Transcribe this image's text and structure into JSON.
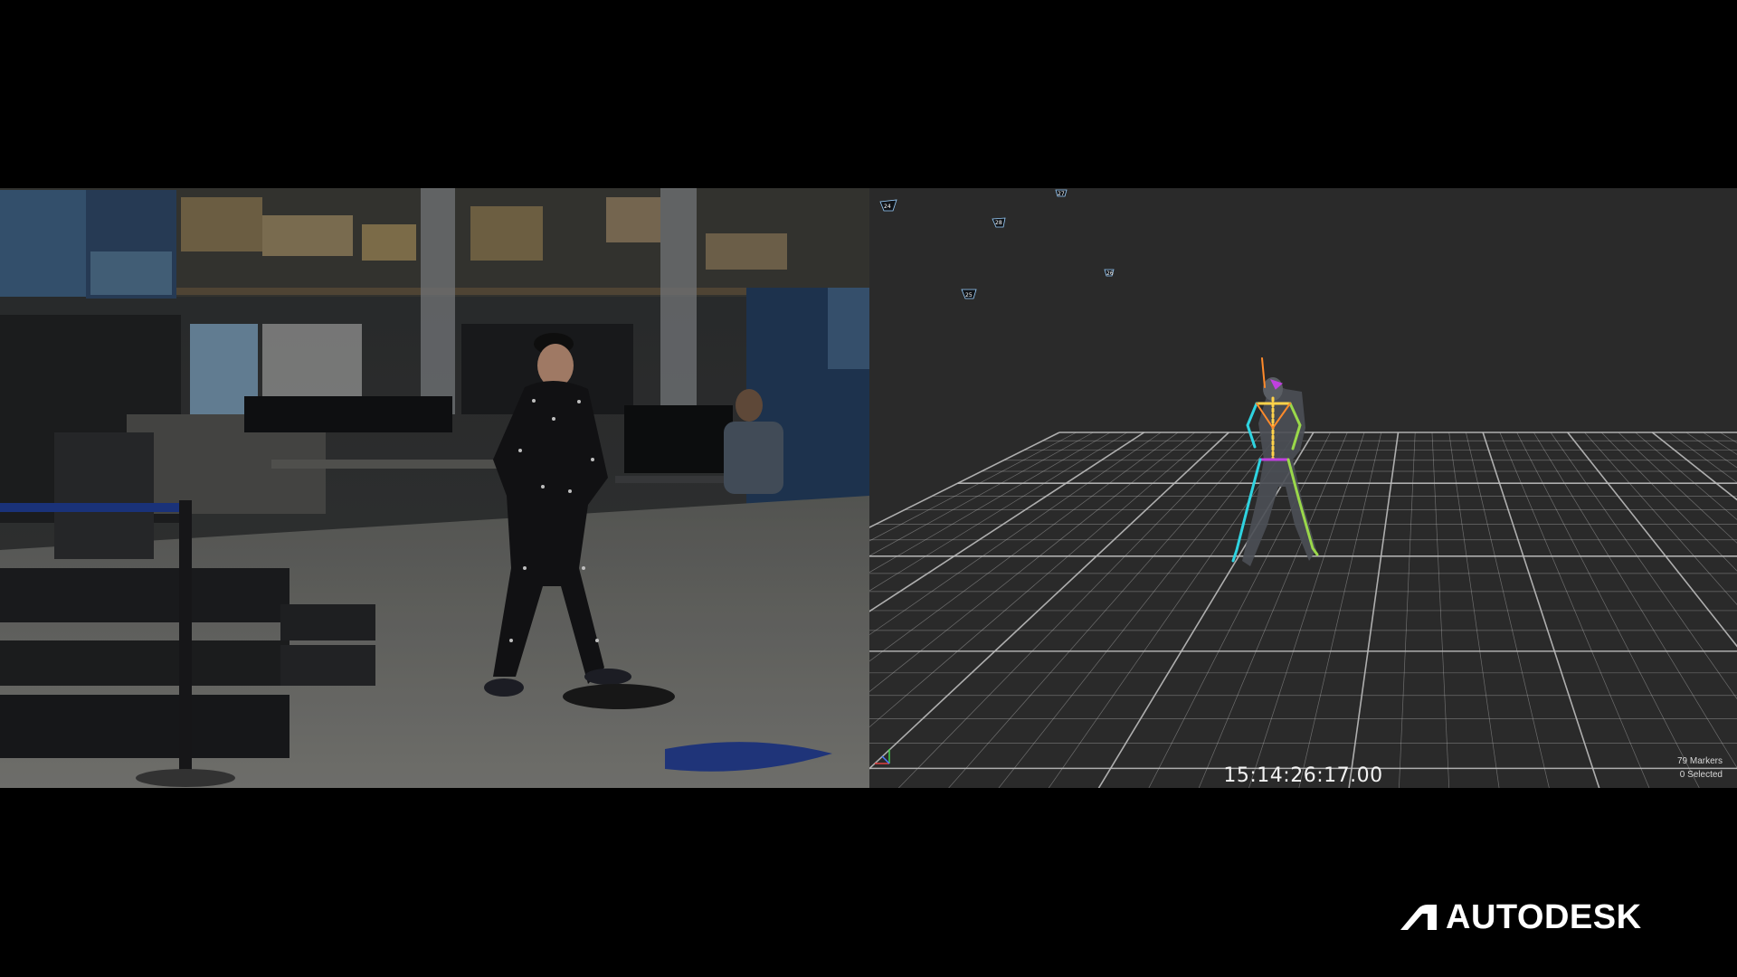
{
  "viewport": {
    "timecode": "15:14:26:17.00",
    "marker_count": "79 Markers",
    "selected_count": "0 Selected",
    "camera_labels": [
      "24",
      "28",
      "27",
      "26",
      "25"
    ]
  },
  "brand": {
    "name": "AUTODESK"
  },
  "colors": {
    "viewport_bg": "#2a2a2a",
    "grid": "#bdbdbd",
    "spine": "#ffd24a",
    "left_side": "#2fd3e0",
    "right_side": "#9ad84a",
    "hips": "#c040e0",
    "head": "#ff8a2a"
  }
}
